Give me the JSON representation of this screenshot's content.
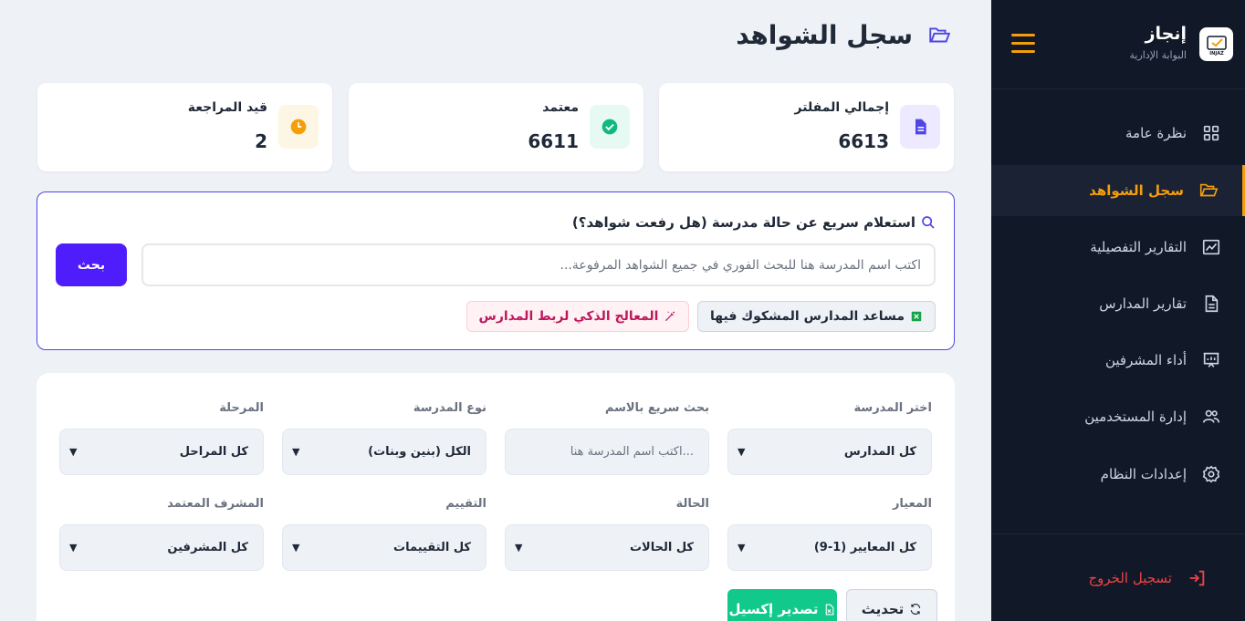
{
  "sidebar": {
    "brand_title": "إنجاز",
    "brand_subtitle": "البوابة الإدارية",
    "logo_text": "INJAZ",
    "items": [
      {
        "label": "نظرة عامة",
        "icon": "grid-icon"
      },
      {
        "label": "سجل الشواهد",
        "icon": "folder-open-icon",
        "active": true
      },
      {
        "label": "التقارير التفصيلية",
        "icon": "chart-line-icon"
      },
      {
        "label": "تقارير المدارس",
        "icon": "file-text-icon"
      },
      {
        "label": "أداء المشرفين",
        "icon": "presentation-icon"
      },
      {
        "label": "إدارة المستخدمين",
        "icon": "users-icon"
      },
      {
        "label": "إعدادات النظام",
        "icon": "gear-icon"
      }
    ],
    "logout_label": "تسجيل الخروج"
  },
  "page": {
    "title": "سجل الشواهد"
  },
  "stats": [
    {
      "label": "إجمالي المفلتر",
      "value": "6613",
      "icon": "file-icon",
      "color": "#4f46e5"
    },
    {
      "label": "معتمد",
      "value": "6611",
      "icon": "check-circle-icon",
      "color": "#10b981"
    },
    {
      "label": "قيد المراجعة",
      "value": "2",
      "icon": "clock-icon",
      "color": "#f59e0b"
    }
  ],
  "query": {
    "title": "استعلام سريع عن حالة مدرسة (هل رفعت شواهد؟)",
    "placeholder": "اكتب اسم المدرسة هنا للبحث الفوري في جميع الشواهد المرفوعة...",
    "search_label": "بحث",
    "chip_suspect": "مساعد المدارس المشكوك فيها",
    "chip_ai": "المعالج الذكي لربط المدارس"
  },
  "filters": {
    "school_label": "اختر المدرسة",
    "school_value": "كل المدارس",
    "name_label": "بحث سريع بالاسم",
    "name_placeholder": "اكتب اسم المدرسة هنا...",
    "type_label": "نوع المدرسة",
    "type_value": "الكل (بنين وبنات)",
    "stage_label": "المرحلة",
    "stage_value": "كل المراحل",
    "criterion_label": "المعيار",
    "criterion_value": "كل المعايير (1-9)",
    "status_label": "الحالة",
    "status_value": "كل الحالات",
    "rating_label": "التقييم",
    "rating_value": "كل التقييمات",
    "supervisor_label": "المشرف المعتمد",
    "supervisor_value": "كل المشرفين",
    "export_label": "تصدير إكسيل",
    "refresh_label": "تحديث"
  },
  "colors": {
    "accent": "#f59e0b",
    "primary": "#4f1cfb",
    "sidebar_bg": "#111827",
    "export_green": "#10c98a",
    "logout_red": "#ef4444"
  }
}
